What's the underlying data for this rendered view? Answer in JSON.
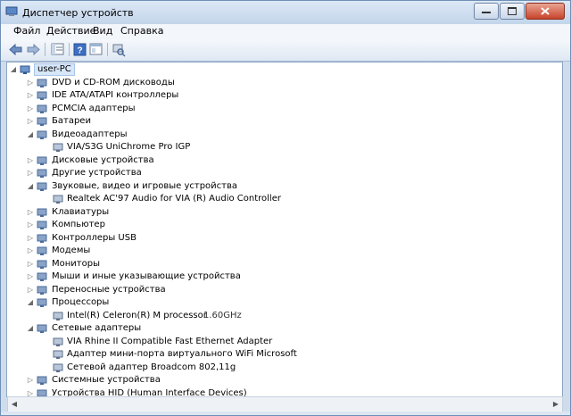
{
  "window": {
    "title": "Диспетчер устройств"
  },
  "menu": [
    "Файл",
    "Действие",
    "Вид",
    "Справка"
  ],
  "toolbar": {
    "buttons": [
      "back-icon",
      "forward-icon",
      "properties-list-icon",
      "help-icon",
      "view-icon",
      "scan-hardware-icon"
    ]
  },
  "tree": {
    "root": "user-PC",
    "items": [
      {
        "label": "DVD и CD-ROM дисководы",
        "level": 1,
        "expanded": false
      },
      {
        "label": "IDE ATA/ATAPI контроллеры",
        "level": 1,
        "expanded": false
      },
      {
        "label": "PCMCIA адаптеры",
        "level": 1,
        "expanded": false
      },
      {
        "label": "Батареи",
        "level": 1,
        "expanded": false
      },
      {
        "label": "Видеоадаптеры",
        "level": 1,
        "expanded": true
      },
      {
        "label": "VIA/S3G UniChrome Pro IGP",
        "level": 2
      },
      {
        "label": "Дисковые устройства",
        "level": 1,
        "expanded": false
      },
      {
        "label": "Другие устройства",
        "level": 1,
        "expanded": false
      },
      {
        "label": "Звуковые, видео и игровые устройства",
        "level": 1,
        "expanded": true
      },
      {
        "label": "Realtek AC'97 Audio for VIA (R) Audio Controller",
        "level": 2
      },
      {
        "label": "Клавиатуры",
        "level": 1,
        "expanded": false
      },
      {
        "label": "Компьютер",
        "level": 1,
        "expanded": false
      },
      {
        "label": "Контроллеры USB",
        "level": 1,
        "expanded": false
      },
      {
        "label": "Модемы",
        "level": 1,
        "expanded": false
      },
      {
        "label": "Мониторы",
        "level": 1,
        "expanded": false
      },
      {
        "label": "Мыши и иные указывающие устройства",
        "level": 1,
        "expanded": false
      },
      {
        "label": "Переносные устройства",
        "level": 1,
        "expanded": false
      },
      {
        "label": "Процессоры",
        "level": 1,
        "expanded": true
      },
      {
        "label": "Intel(R) Celeron(R) M processor",
        "extra": "1.60GHz",
        "level": 2
      },
      {
        "label": "Сетевые адаптеры",
        "level": 1,
        "expanded": true
      },
      {
        "label": "VIA Rhine II Compatible Fast Ethernet Adapter",
        "level": 2
      },
      {
        "label": "Адаптер мини-порта виртуального WiFi Microsoft",
        "level": 2
      },
      {
        "label": "Сетевой адаптер Broadcom 802,11g",
        "level": 2
      },
      {
        "label": "Системные устройства",
        "level": 1,
        "expanded": false
      },
      {
        "label": "Устройства HID (Human Interface Devices)",
        "level": 1,
        "expanded": false
      }
    ]
  },
  "colors": {
    "titlebar": "#c3d5ea",
    "selection": "#d7e7f9",
    "close_button": "#c7432a"
  }
}
